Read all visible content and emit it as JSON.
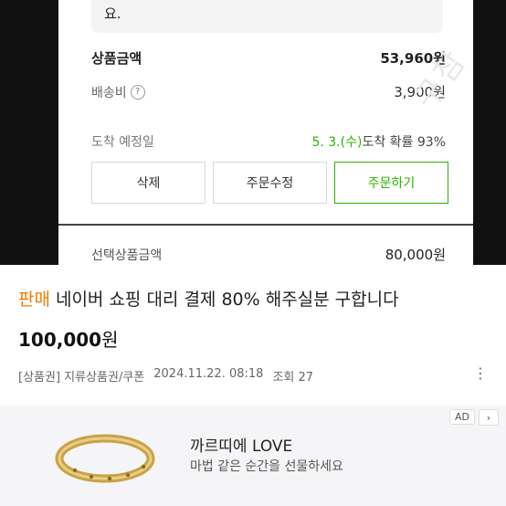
{
  "screenshot": {
    "message_text": "요.",
    "amount_label": "상품금액",
    "amount_value": "53,960원",
    "shipping_label": "배송비",
    "shipping_help_icon": "?",
    "shipping_value": "3,900원",
    "eta_label": "도착 예정일",
    "eta_date": "5. 3.(수)",
    "eta_probability": "도착 확률 93%",
    "buttons": {
      "delete": "삭제",
      "edit": "주문수정",
      "order": "주문하기"
    },
    "selected_label": "선택상품금액",
    "selected_value": "80,000원",
    "watermark": "구참"
  },
  "listing": {
    "status": "판매",
    "title": "네이버 쇼핑 대리 결제 80% 해주실분 구합니다",
    "price_number": "100,000",
    "price_unit": "원",
    "category": "[상품권] 지류상품권/쿠폰",
    "date": "2024.11.22. 08:18",
    "views": "조회 27",
    "more_icon": "⋮"
  },
  "ad": {
    "badge": "AD",
    "close_icon": "›",
    "title": "까르띠에 LOVE",
    "subtitle": "마법 같은 순간을 선물하세요",
    "image_icon": "gold-bracelet"
  },
  "colors": {
    "accent_green": "#2db400",
    "status_orange": "#f27a00"
  }
}
